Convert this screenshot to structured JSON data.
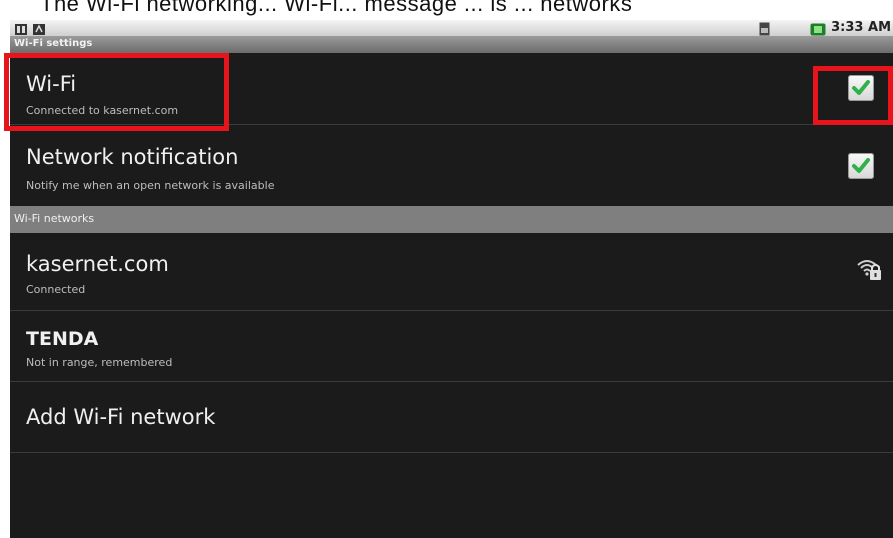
{
  "caption_fragment": "The Wi-Fi networking... Wi-Fi... message ... is ... networks",
  "status_bar": {
    "time": "3:33 AM",
    "left_icons": [
      "sd-card-icon",
      "usb-debug-icon"
    ],
    "right_icons": [
      "sim-icon",
      "battery-icon"
    ]
  },
  "title_bar": {
    "title": "Wi-Fi settings"
  },
  "wifi_toggle": {
    "label": "Wi-Fi",
    "status": "Connected to kasernet.com",
    "checked": true
  },
  "network_notification": {
    "label": "Network notification",
    "description": "Notify me when an open network is available",
    "checked": true
  },
  "section": {
    "networks_header": "Wi-Fi networks"
  },
  "networks": [
    {
      "name": "kasernet.com",
      "status": "Connected",
      "icon": "wifi-lock-icon"
    },
    {
      "name": "TENDA",
      "status": "Not in range, remembered",
      "icon": ""
    }
  ],
  "add_network": {
    "label": "Add Wi-Fi network"
  },
  "colors": {
    "background": "#1b1b1b",
    "highlight": "#e8141b",
    "check_green": "#2fb24a",
    "section_header": "#7f7f7f"
  }
}
